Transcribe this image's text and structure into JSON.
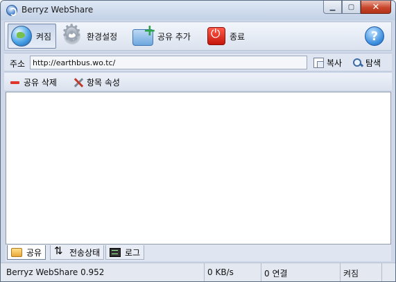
{
  "window": {
    "title": "Berryz WebShare",
    "minimize_glyph": "▁",
    "maximize_glyph": "▢",
    "close_glyph": "✕"
  },
  "toolbar": {
    "start_label": "켜짐",
    "settings_label": "환경설정",
    "add_share_label": "공유 추가",
    "exit_label": "종료",
    "help_glyph": "?"
  },
  "address": {
    "label": "주소",
    "value": "http://earthbus.wo.tc/",
    "copy_label": "복사",
    "browse_label": "탐색"
  },
  "actions": {
    "delete_share_label": "공유 삭제",
    "properties_label": "항목 속성"
  },
  "tabs": [
    {
      "label": "공유",
      "icon": "folder-icon"
    },
    {
      "label": "전송상태",
      "icon": "transfer-arrows-icon"
    },
    {
      "label": "로그",
      "icon": "log-icon"
    }
  ],
  "status": {
    "version": "Berryz WebShare 0.952",
    "speed": "0 KB/s",
    "connections": "0 연결",
    "state": "켜짐"
  },
  "colors": {
    "window_frame": "#cfd8e8",
    "close_button": "#c8462b",
    "exit_icon": "#e0352b"
  }
}
